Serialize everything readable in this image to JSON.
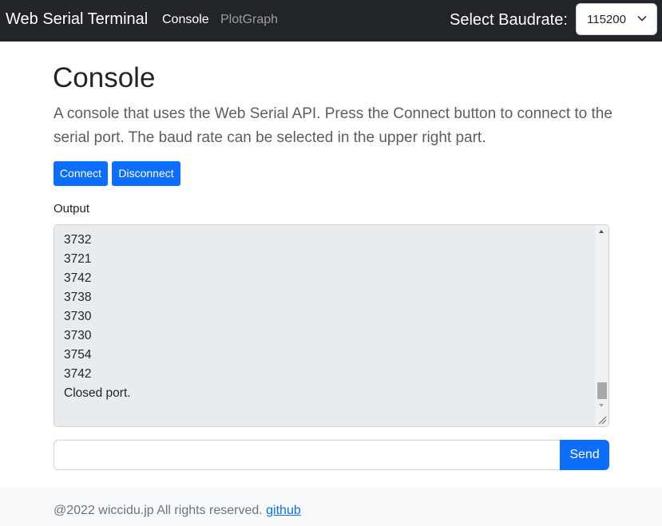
{
  "navbar": {
    "brand": "Web Serial Terminal",
    "nav_items": [
      {
        "label": "Console",
        "active": true
      },
      {
        "label": "PlotGraph",
        "active": false
      }
    ],
    "baud_label": "Select Baudrate:",
    "baud_select": {
      "value": "115200",
      "icon": "chevron-down-icon"
    }
  },
  "main": {
    "title": "Console",
    "lead": "A console that uses the Web Serial API. Press the Connect button to connect to the serial port. The baud rate can be selected in the upper right part.",
    "buttons": {
      "connect": "Connect",
      "disconnect": "Disconnect"
    },
    "output_label": "Output",
    "output_lines": [
      "3732",
      "3721",
      "3742",
      "3738",
      "3730",
      "3730",
      "3754",
      "3742",
      "Closed port."
    ],
    "send_input": {
      "value": "",
      "placeholder": ""
    },
    "send_label": "Send"
  },
  "footer": {
    "text": "@2022 wiccidu.jp All rights reserved.",
    "link": "github"
  },
  "colors": {
    "navbar_bg": "#212529",
    "primary": "#0d6efd",
    "output_bg": "#e9ecef",
    "footer_bg": "#f8f9fa"
  }
}
